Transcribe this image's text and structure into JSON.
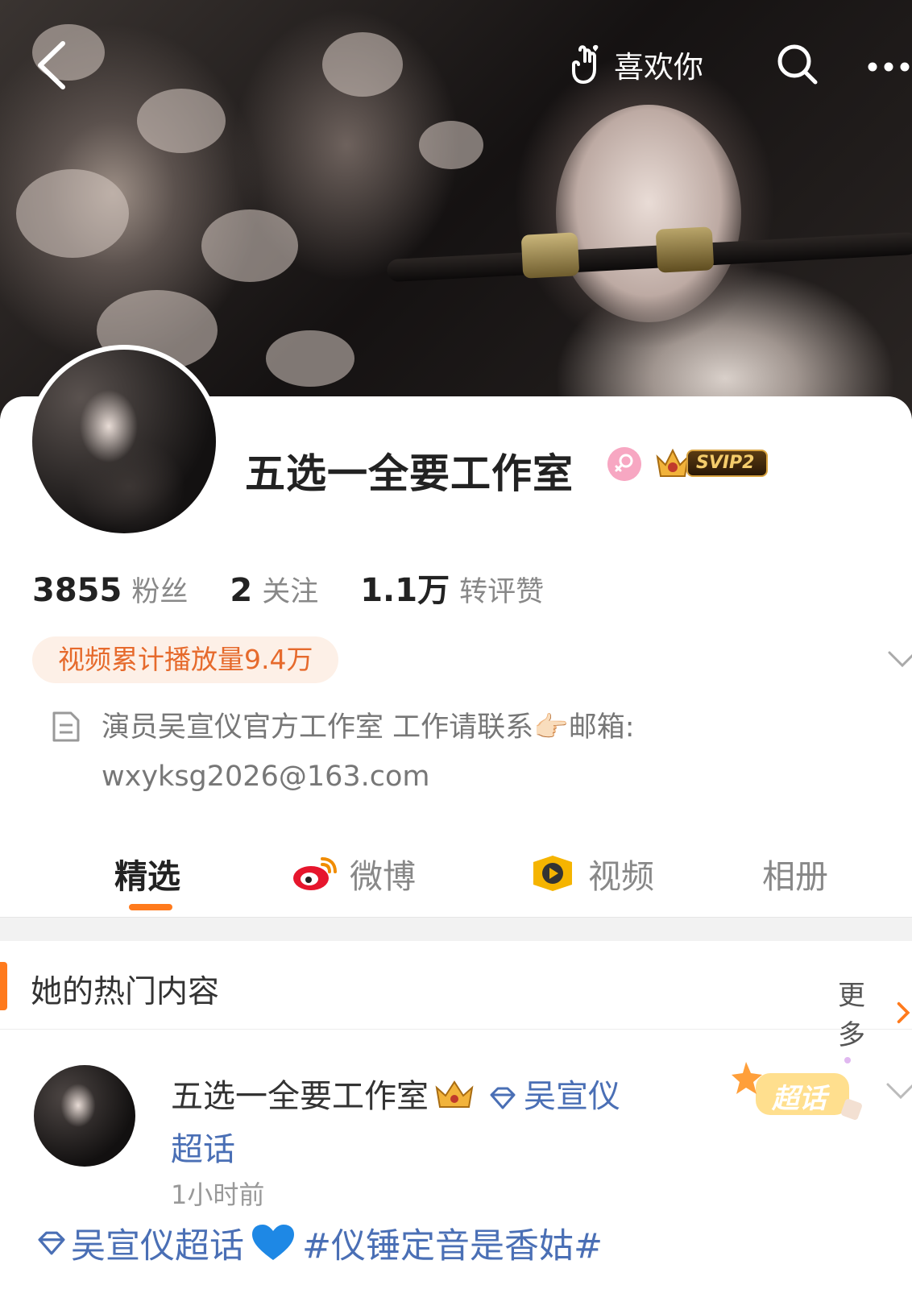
{
  "header": {
    "like_label": "喜欢你",
    "icons": [
      "back-icon",
      "hand-heart-icon",
      "search-icon",
      "more-icon"
    ]
  },
  "profile": {
    "name": "五选一全要工作室",
    "svip_label": "SVIP2",
    "stats": [
      {
        "value": "3855",
        "label": "粉丝"
      },
      {
        "value": "2",
        "label": "关注"
      },
      {
        "value": "1.1万",
        "label": "转评赞"
      }
    ],
    "play_count": "视频累计播放量9.4万",
    "bio_line1": "演员吴宣仪官方工作室 工作请联系👉🏻邮箱:",
    "bio_line2": "wxyksg2026@163.com"
  },
  "tabs": [
    {
      "label": "精选",
      "active": true
    },
    {
      "label": "微博",
      "active": false
    },
    {
      "label": "视频",
      "active": false
    },
    {
      "label": "相册",
      "active": false
    }
  ],
  "section": {
    "title": "她的热门内容",
    "more": "更多"
  },
  "post": {
    "author": "五选一全要工作室",
    "topic": "吴宣仪超话",
    "time": "1小时前",
    "badge": "超话",
    "body_topic": "吴宣仪超话",
    "body_hashtag": "#仪锤定音是香姑#"
  },
  "colors": {
    "accent": "#ff7a1c",
    "link": "#4a6fb5",
    "pill_bg": "#fdf0e7",
    "pill_text": "#e66a2c"
  }
}
